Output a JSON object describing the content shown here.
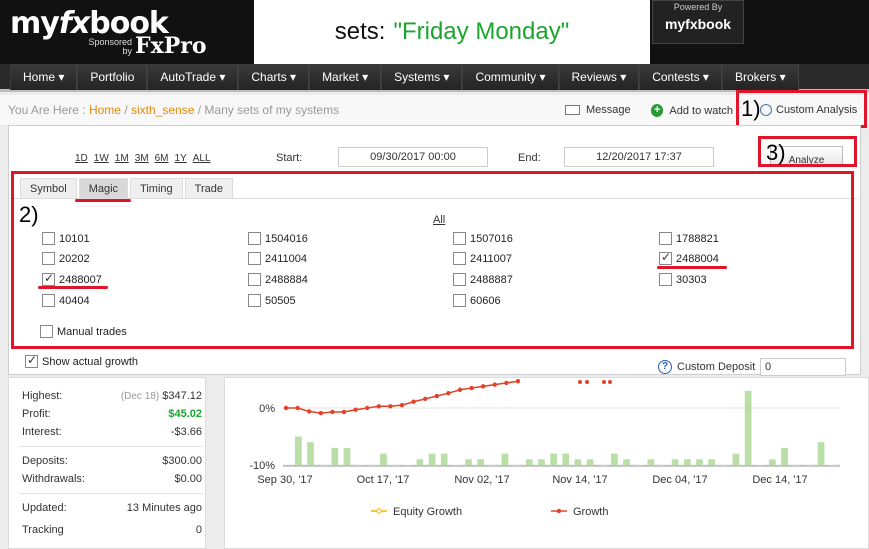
{
  "header": {
    "logo_my": "my",
    "logo_fx": "fx",
    "logo_book": "book",
    "sponsored_by": "Sponsored by",
    "sponsor": "FxPro",
    "sets_prefix": "sets:",
    "sets_value": "\"Friday Monday\"",
    "powered_by": "Powered By",
    "powered_logo": "myfxbook"
  },
  "nav": {
    "items": [
      "Home ▾",
      "Portfolio",
      "AutoTrade ▾",
      "Charts ▾",
      "Market ▾",
      "Systems ▾",
      "Community ▾",
      "Reviews ▾",
      "Contests ▾",
      "Brokers ▾"
    ]
  },
  "breadcrumb": {
    "prefix": "You Are Here :",
    "home": "Home",
    "sep1": "/",
    "user": "sixth_sense",
    "sep2": "/",
    "current": "Many sets of my systems"
  },
  "actions": {
    "message": "Message",
    "add_watch": "Add to watch",
    "custom_analysis": "Custom Analysis"
  },
  "annotations": {
    "a1": "1)",
    "a2": "2)",
    "a3": "3)"
  },
  "analysis": {
    "ranges": [
      "1D",
      "1W",
      "1M",
      "3M",
      "6M",
      "1Y",
      "ALL"
    ],
    "start_label": "Start:",
    "start_value": "09/30/2017 00:00",
    "end_label": "End:",
    "end_value": "12/20/2017 17:37",
    "analyze_label": "Analyze",
    "tabs": [
      "Symbol",
      "Magic",
      "Timing",
      "Trade"
    ],
    "active_tab": "Magic",
    "all_label": "All",
    "magic_items": [
      {
        "label": "10101",
        "checked": false
      },
      {
        "label": "1504016",
        "checked": false
      },
      {
        "label": "1507016",
        "checked": false
      },
      {
        "label": "1788821",
        "checked": false
      },
      {
        "label": "20202",
        "checked": false
      },
      {
        "label": "2411004",
        "checked": false
      },
      {
        "label": "2411007",
        "checked": false
      },
      {
        "label": "2488004",
        "checked": true
      },
      {
        "label": "2488007",
        "checked": true
      },
      {
        "label": "2488884",
        "checked": false
      },
      {
        "label": "2488887",
        "checked": false
      },
      {
        "label": "30303",
        "checked": false
      },
      {
        "label": "40404",
        "checked": false
      },
      {
        "label": "50505",
        "checked": false
      },
      {
        "label": "60606",
        "checked": false
      }
    ],
    "manual_trades": "Manual trades",
    "show_growth": "Show actual growth",
    "custom_deposit_label": "Custom Deposit",
    "custom_deposit_value": "0"
  },
  "stats": {
    "highest_label": "Highest:",
    "highest_date": "(Dec 18)",
    "highest_value": "$347.12",
    "profit_label": "Profit:",
    "profit_value": "$45.02",
    "interest_label": "Interest:",
    "interest_value": "-$3.66",
    "deposits_label": "Deposits:",
    "deposits_value": "$300.00",
    "withdrawals_label": "Withdrawals:",
    "withdrawals_value": "$0.00",
    "updated_label": "Updated:",
    "updated_value": "13 Minutes ago",
    "tracking_label": "Tracking",
    "tracking_value": "0"
  },
  "colors": {
    "accent_orange": "#e38a0b",
    "profit_green": "#1aa52c",
    "annotation_red": "#e0152a",
    "growth_line": "#e0432a",
    "equity_line": "#f0b400",
    "bars": "#b9dfa6"
  },
  "chart_data": {
    "type": "line",
    "x_ticks": [
      "Sep 30, '17",
      "Oct 17, '17",
      "Nov 02, '17",
      "Nov 14, '17",
      "Dec 04, '17",
      "Dec 14, '17"
    ],
    "y_ticks": [
      "0%",
      "-10%"
    ],
    "series": [
      {
        "name": "Equity Growth",
        "values": []
      },
      {
        "name": "Growth",
        "values": [
          0.0,
          0.0,
          -0.6,
          -0.9,
          -0.7,
          -0.7,
          -0.3,
          0.0,
          0.3,
          0.3,
          0.5,
          1.1,
          1.6,
          2.1,
          2.6,
          3.2,
          3.5,
          3.8,
          4.1,
          4.4,
          4.7
        ]
      },
      {
        "name": "Daily",
        "values": [
          -5,
          -6,
          -10,
          -7,
          -7,
          -10,
          -10,
          -8,
          -10,
          -10,
          -9,
          -8,
          -8,
          -10,
          -9,
          -9,
          -10,
          -8,
          -10,
          -9,
          -9,
          -8,
          -8,
          -9,
          -9,
          -10,
          -8,
          -9,
          -10,
          -9,
          -10,
          -9,
          -9,
          -9,
          -9,
          -10,
          -8,
          3,
          -10,
          -9,
          -7,
          -10,
          -10,
          -6,
          -10
        ]
      }
    ],
    "legend": [
      "Equity Growth",
      "Growth"
    ]
  }
}
